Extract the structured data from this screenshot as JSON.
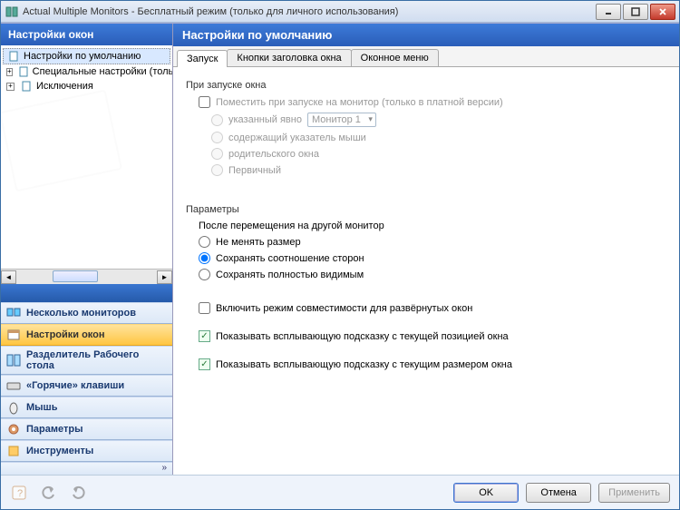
{
  "titlebar": {
    "title": "Actual Multiple Monitors - Бесплатный режим (только для личного использования)"
  },
  "sidebar": {
    "header": "Настройки окон",
    "tree": [
      {
        "label": "Настройки по умолчанию"
      },
      {
        "label": "Специальные настройки (только в плат"
      },
      {
        "label": "Исключения"
      }
    ]
  },
  "nav": {
    "items": [
      {
        "label": "Несколько мониторов"
      },
      {
        "label": "Настройки окон"
      },
      {
        "label": "Разделитель Рабочего стола"
      },
      {
        "label": "«Горячие» клавиши"
      },
      {
        "label": "Мышь"
      },
      {
        "label": "Параметры"
      },
      {
        "label": "Инструменты"
      }
    ]
  },
  "main": {
    "header": "Настройки по умолчанию",
    "tabs": [
      {
        "label": "Запуск"
      },
      {
        "label": "Кнопки заголовка окна"
      },
      {
        "label": "Оконное меню"
      }
    ],
    "group_launch": "При запуске окна",
    "place_on_monitor": "Поместить при запуске на монитор (только в платной версии)",
    "opt_explicit": "указанный явно",
    "monitor_select": "Монитор 1",
    "opt_pointer": "содержащий указатель мыши",
    "opt_parent": "родительского окна",
    "opt_primary": "Первичный",
    "group_params": "Параметры",
    "after_move": "После перемещения на другой монитор",
    "keep_size": "Не менять размер",
    "keep_ratio": "Сохранять соотношение сторон",
    "keep_visible": "Сохранять полностью видимым",
    "compat_mode": "Включить режим совместимости для развёрнутых окон",
    "tooltip_pos": "Показывать всплывающую подсказку с текущей позицией окна",
    "tooltip_size": "Показывать всплывающую подсказку с текущим размером окна"
  },
  "footer": {
    "ok": "OK",
    "cancel": "Отмена",
    "apply": "Применить"
  }
}
